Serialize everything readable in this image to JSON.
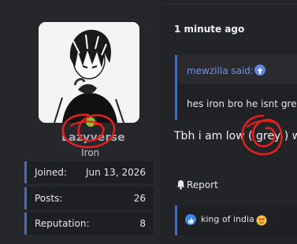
{
  "user": {
    "username": "Lazyverse",
    "rank": "Iron",
    "stats": [
      {
        "label": "Joined:",
        "value": "Jun 13, 2026"
      },
      {
        "label": "Posts:",
        "value": "26"
      },
      {
        "label": "Reputation:",
        "value": "8"
      }
    ]
  },
  "post": {
    "timestamp": "1 minute ago",
    "quote": {
      "author": "mewzilla said:",
      "text": "hes iron bro he isnt grey"
    },
    "message": "Tbh i am low ( grey ) wil",
    "report_label": "Report",
    "reactions": {
      "users": "king of india"
    }
  },
  "colors": {
    "accent": "#4a6bb6",
    "online": "#8fbf2f",
    "annotation": "#e32020"
  }
}
